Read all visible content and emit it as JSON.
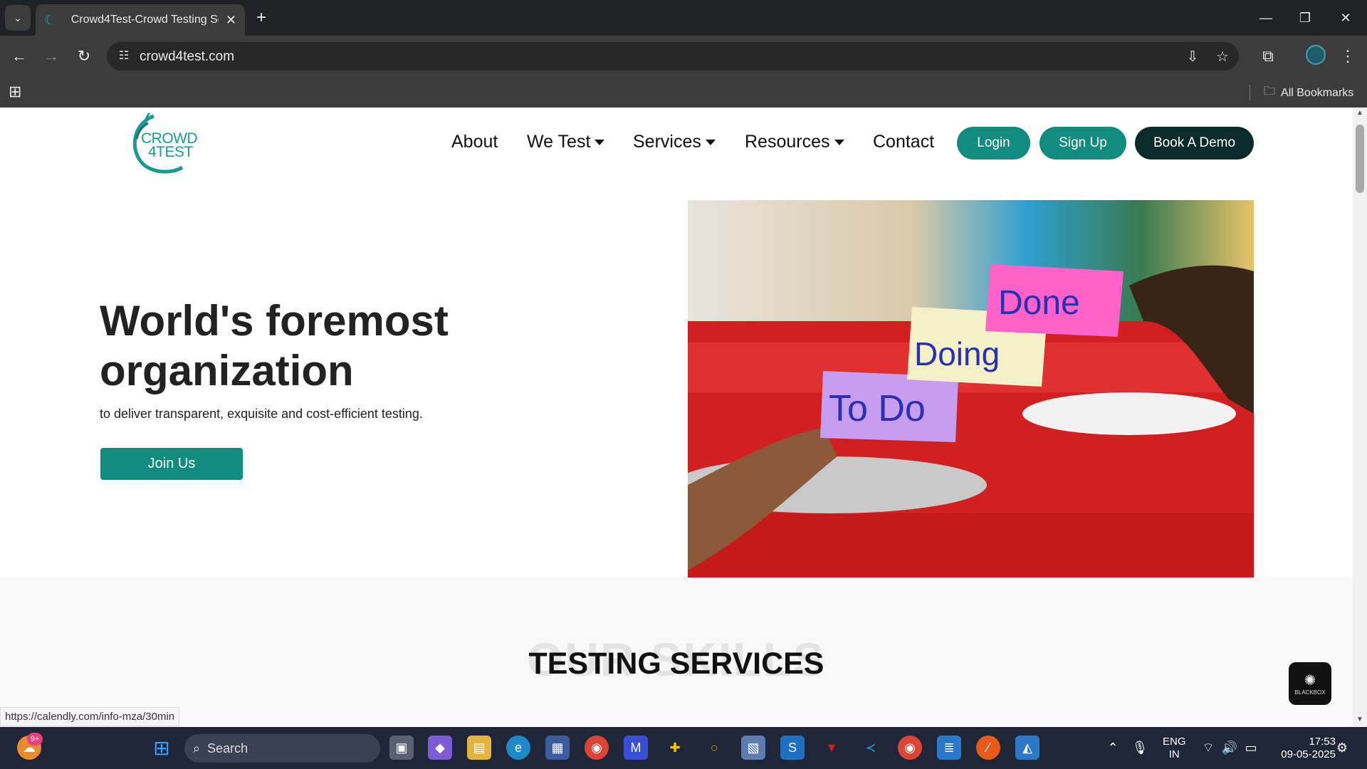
{
  "browser": {
    "tab_title": "Crowd4Test-Crowd Testing Serv",
    "url": "crowd4test.com",
    "all_bookmarks": "All Bookmarks",
    "status_url": "https://calendly.com/info-mza/30min"
  },
  "site": {
    "logo": {
      "line1": "CROWD",
      "line2": "4TEST"
    },
    "nav": {
      "about": "About",
      "we_test": "We Test",
      "services": "Services",
      "resources": "Resources",
      "contact": "Contact"
    },
    "buttons": {
      "login": "Login",
      "signup": "Sign Up",
      "demo": "Book A Demo"
    },
    "hero": {
      "title_line1": "World's foremost",
      "title_line2": "organization",
      "subtitle": "to deliver transparent, exquisite and cost-efficient testing.",
      "cta": "Join Us",
      "notes": [
        "Done",
        "Doing",
        "To Do"
      ]
    },
    "skills": {
      "background_text": "OUR SKILLS",
      "title": "TESTING SERVICES"
    },
    "widget": "BLACKBOX"
  },
  "taskbar": {
    "search_placeholder": "Search",
    "notification_badge": "9+",
    "language": "ENG",
    "region": "IN",
    "time": "17:53",
    "date": "09-05-2025"
  },
  "colors": {
    "brand_teal": "#128c7e",
    "dark_button": "#0b2b2b",
    "tab_bar": "#202124"
  }
}
